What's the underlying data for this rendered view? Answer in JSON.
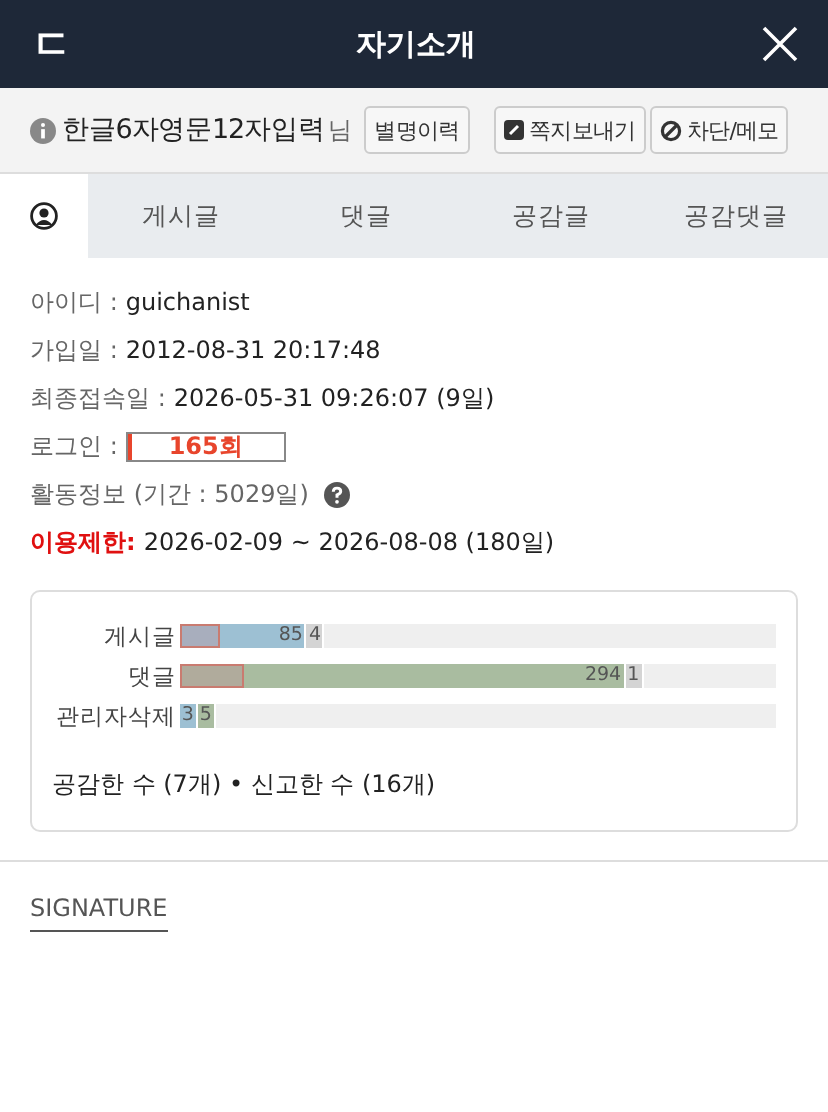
{
  "header": {
    "back_icon": "ㄷ",
    "title": "자기소개"
  },
  "profile": {
    "nickname": "한글6자영문12자입력",
    "suffix": "님",
    "buttons": [
      {
        "kind": "history",
        "label": "별명이력"
      },
      {
        "kind": "message",
        "label": "쪽지보내기"
      },
      {
        "kind": "block",
        "label": "차단/메모"
      }
    ]
  },
  "tabs": [
    {
      "kind": "icon",
      "selected": true
    },
    {
      "label": "게시글",
      "selected": false
    },
    {
      "label": "댓글",
      "selected": false
    },
    {
      "label": "공감글",
      "selected": false
    },
    {
      "label": "공감댓글",
      "selected": false
    }
  ],
  "info": [
    {
      "kind": "text",
      "label": "아이디 :",
      "value": "guichanist"
    },
    {
      "kind": "text",
      "label": "가입일 :",
      "value": "2012-08-31 20:17:48"
    },
    {
      "kind": "text",
      "label": "최종접속일 :",
      "value": "2026-05-31 09:26:07 (9일)"
    },
    {
      "kind": "meter",
      "label": "로그인 :",
      "value": "165회",
      "level": 0.03
    },
    {
      "kind": "help",
      "label": "활동정보 (기간 : 5029일)"
    },
    {
      "kind": "warning",
      "label": "이용제한:",
      "value": "2026-02-09 ~ 2026-08-08 (180일)"
    }
  ],
  "activity": {
    "rows": [
      {
        "label": "게시글",
        "bar": {
          "kind": "blue",
          "level": 0.213,
          "text": "85"
        },
        "extra": [
          {
            "kind": "grey",
            "text": "4"
          }
        ],
        "marker": {
          "level": 0.067
        }
      },
      {
        "label": "댓글",
        "bar": {
          "kind": "green",
          "level": 0.747,
          "text": "294"
        },
        "extra": [
          {
            "kind": "grey",
            "text": "1"
          }
        ],
        "marker": {
          "level": 0.107
        }
      },
      {
        "label": "관리자삭제",
        "bar": {
          "kind": "blue",
          "level": 0.03,
          "text": "3"
        },
        "extra": [
          {
            "kind": "green",
            "text": "5"
          }
        ]
      }
    ],
    "summary": "공감한 수 (7개) • 신고한 수 (16개)"
  },
  "signature_tab": "SIGNATURE"
}
